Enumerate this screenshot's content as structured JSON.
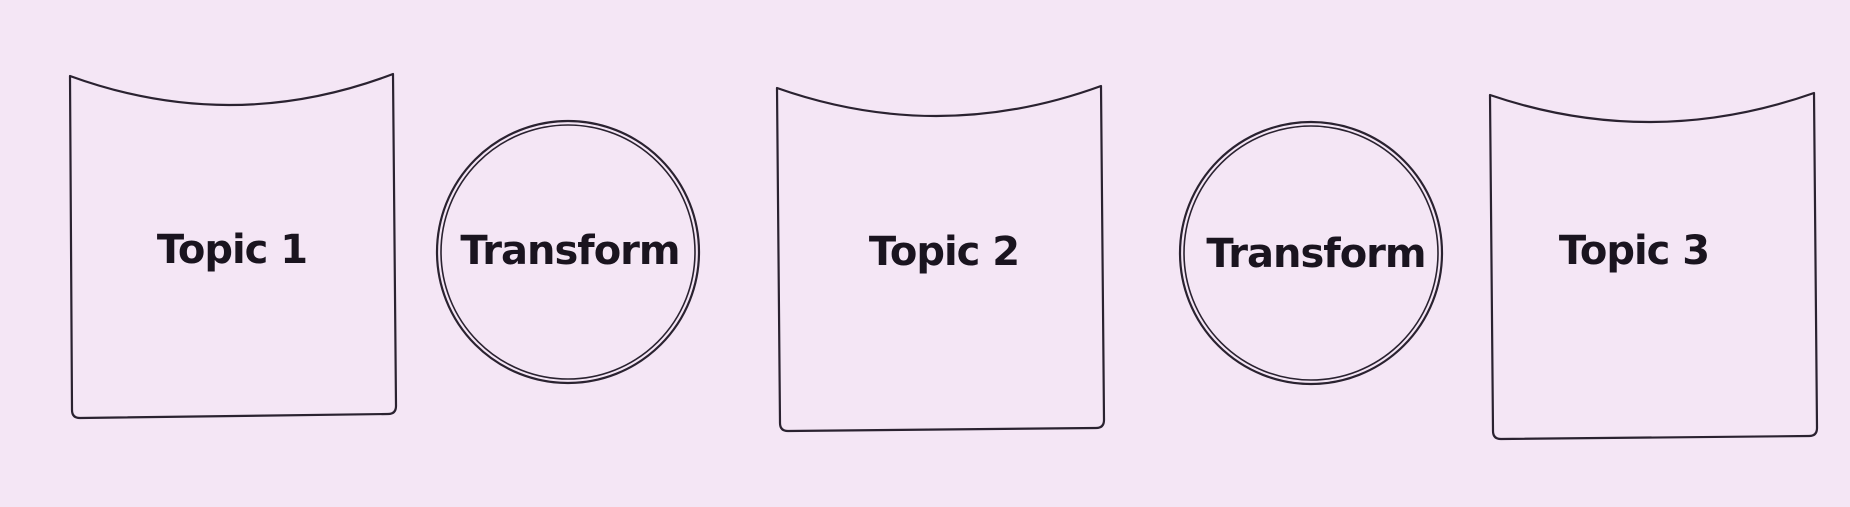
{
  "diagram": {
    "background": "#f4e6f5",
    "stroke_color": "#2a2230",
    "text_color": "#1a141f",
    "nodes": [
      {
        "id": "topic-1",
        "shape": "cylinder",
        "label": "Topic 1"
      },
      {
        "id": "transform-1",
        "shape": "circle",
        "label": "Transform"
      },
      {
        "id": "topic-2",
        "shape": "cylinder",
        "label": "Topic 2"
      },
      {
        "id": "transform-2",
        "shape": "circle",
        "label": "Transform"
      },
      {
        "id": "topic-3",
        "shape": "cylinder",
        "label": "Topic 3"
      }
    ]
  }
}
